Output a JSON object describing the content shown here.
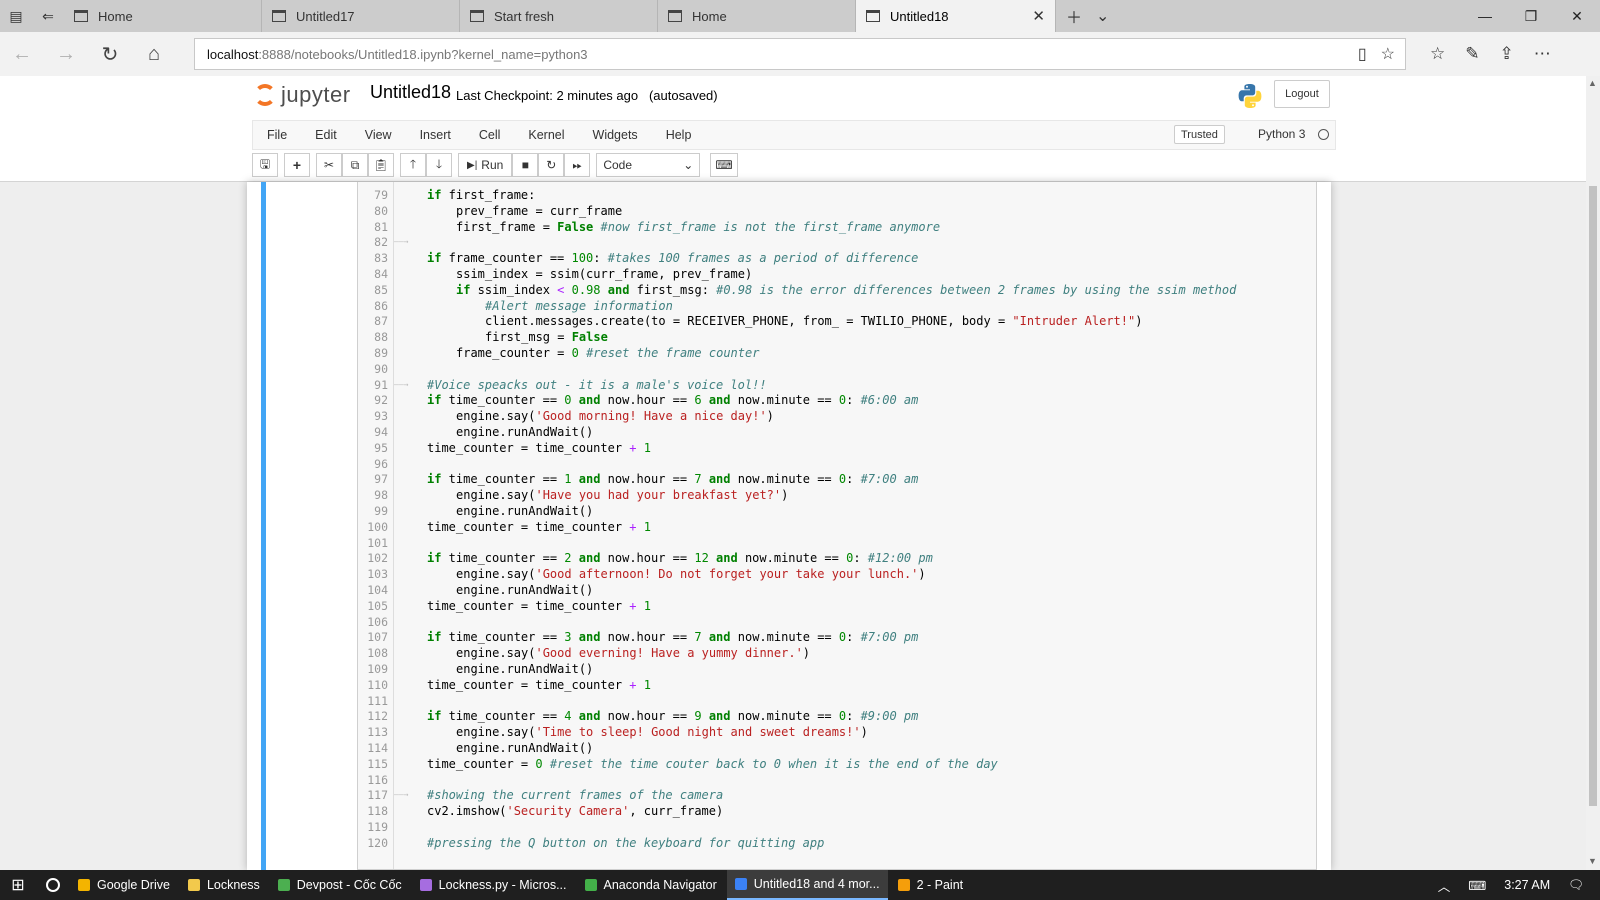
{
  "browser": {
    "tabs": [
      {
        "label": "Home",
        "active": false
      },
      {
        "label": "Untitled17",
        "active": false
      },
      {
        "label": "Start fresh",
        "active": false
      },
      {
        "label": "Home",
        "active": false
      },
      {
        "label": "Untitled18",
        "active": true
      }
    ],
    "url_host": "localhost",
    "url_rest": ":8888/notebooks/Untitled18.ipynb?kernel_name=python3"
  },
  "jupyter": {
    "logo_text": "jupyter",
    "notebook_name": "Untitled18",
    "checkpoint": "Last Checkpoint: 2 minutes ago",
    "autosave": "(autosaved)",
    "logout_label": "Logout",
    "menu": [
      "File",
      "Edit",
      "View",
      "Insert",
      "Cell",
      "Kernel",
      "Widgets",
      "Help"
    ],
    "trusted_label": "Trusted",
    "kernel_name": "Python 3",
    "run_label": "Run",
    "cell_type": "Code"
  },
  "code_lines": [
    {
      "n": "79",
      "indent": 1,
      "tokens": [
        [
          "kw",
          "if"
        ],
        [
          "t",
          " first_frame:"
        ]
      ]
    },
    {
      "n": "80",
      "indent": 2,
      "tokens": [
        [
          "t",
          "prev_frame = curr_frame"
        ]
      ]
    },
    {
      "n": "81",
      "indent": 2,
      "tokens": [
        [
          "t",
          "first_frame = "
        ],
        [
          "kw",
          "False"
        ],
        [
          "t",
          " "
        ],
        [
          "cm",
          "#now first_frame is not the first_frame anymore"
        ]
      ]
    },
    {
      "n": "82",
      "indent": 0,
      "tokens": [],
      "tabmark": true
    },
    {
      "n": "83",
      "indent": 1,
      "tokens": [
        [
          "kw",
          "if"
        ],
        [
          "t",
          " frame_counter == "
        ],
        [
          "nm",
          "100"
        ],
        [
          "t",
          ": "
        ],
        [
          "cm",
          "#takes 100 frames as a period of difference"
        ]
      ]
    },
    {
      "n": "84",
      "indent": 2,
      "tokens": [
        [
          "t",
          "ssim_index = ssim(curr_frame, prev_frame)"
        ]
      ]
    },
    {
      "n": "85",
      "indent": 2,
      "tokens": [
        [
          "kw",
          "if"
        ],
        [
          "t",
          " ssim_index "
        ],
        [
          "op",
          "<"
        ],
        [
          "t",
          " "
        ],
        [
          "nm",
          "0.98"
        ],
        [
          "t",
          " "
        ],
        [
          "kw",
          "and"
        ],
        [
          "t",
          " first_msg: "
        ],
        [
          "cm",
          "#0.98 is the error differences between 2 frames by using the ssim method"
        ]
      ]
    },
    {
      "n": "86",
      "indent": 3,
      "tokens": [
        [
          "cm",
          "#Alert message information"
        ]
      ]
    },
    {
      "n": "87",
      "indent": 3,
      "tokens": [
        [
          "t",
          "client.messages.create(to = RECEIVER_PHONE, from_ = TWILIO_PHONE, body = "
        ],
        [
          "st",
          "\"Intruder Alert!\""
        ],
        [
          "t",
          ")"
        ]
      ]
    },
    {
      "n": "88",
      "indent": 3,
      "tokens": [
        [
          "t",
          "first_msg = "
        ],
        [
          "kw",
          "False"
        ]
      ]
    },
    {
      "n": "89",
      "indent": 2,
      "tokens": [
        [
          "t",
          "frame_counter = "
        ],
        [
          "nm",
          "0"
        ],
        [
          "t",
          " "
        ],
        [
          "cm",
          "#reset the frame counter"
        ]
      ]
    },
    {
      "n": "90",
      "indent": 0,
      "tokens": []
    },
    {
      "n": "91",
      "indent": 1,
      "tokens": [
        [
          "cm",
          "#Voice speacks out - it is a male's voice lol!!"
        ]
      ],
      "tabmark": true
    },
    {
      "n": "92",
      "indent": 1,
      "tokens": [
        [
          "kw",
          "if"
        ],
        [
          "t",
          " time_counter == "
        ],
        [
          "nm",
          "0"
        ],
        [
          "t",
          " "
        ],
        [
          "kw",
          "and"
        ],
        [
          "t",
          " now.hour == "
        ],
        [
          "nm",
          "6"
        ],
        [
          "t",
          " "
        ],
        [
          "kw",
          "and"
        ],
        [
          "t",
          " now.minute == "
        ],
        [
          "nm",
          "0"
        ],
        [
          "t",
          ": "
        ],
        [
          "cm",
          "#6:00 am"
        ]
      ]
    },
    {
      "n": "93",
      "indent": 2,
      "tokens": [
        [
          "t",
          "engine.say("
        ],
        [
          "st",
          "'Good morning! Have a nice day!'"
        ],
        [
          "t",
          ")"
        ]
      ]
    },
    {
      "n": "94",
      "indent": 2,
      "tokens": [
        [
          "t",
          "engine.runAndWait()"
        ]
      ]
    },
    {
      "n": "95",
      "indent": 1,
      "tokens": [
        [
          "t",
          "time_counter = time_counter "
        ],
        [
          "op",
          "+"
        ],
        [
          "t",
          " "
        ],
        [
          "nm",
          "1"
        ]
      ]
    },
    {
      "n": "96",
      "indent": 0,
      "tokens": []
    },
    {
      "n": "97",
      "indent": 1,
      "tokens": [
        [
          "kw",
          "if"
        ],
        [
          "t",
          " time_counter == "
        ],
        [
          "nm",
          "1"
        ],
        [
          "t",
          " "
        ],
        [
          "kw",
          "and"
        ],
        [
          "t",
          " now.hour == "
        ],
        [
          "nm",
          "7"
        ],
        [
          "t",
          " "
        ],
        [
          "kw",
          "and"
        ],
        [
          "t",
          " now.minute == "
        ],
        [
          "nm",
          "0"
        ],
        [
          "t",
          ": "
        ],
        [
          "cm",
          "#7:00 am"
        ]
      ]
    },
    {
      "n": "98",
      "indent": 2,
      "tokens": [
        [
          "t",
          "engine.say("
        ],
        [
          "st",
          "'Have you had your breakfast yet?'"
        ],
        [
          "t",
          ")"
        ]
      ]
    },
    {
      "n": "99",
      "indent": 2,
      "tokens": [
        [
          "t",
          "engine.runAndWait()"
        ]
      ]
    },
    {
      "n": "100",
      "indent": 1,
      "tokens": [
        [
          "t",
          "time_counter = time_counter "
        ],
        [
          "op",
          "+"
        ],
        [
          "t",
          " "
        ],
        [
          "nm",
          "1"
        ]
      ]
    },
    {
      "n": "101",
      "indent": 0,
      "tokens": []
    },
    {
      "n": "102",
      "indent": 1,
      "tokens": [
        [
          "kw",
          "if"
        ],
        [
          "t",
          " time_counter == "
        ],
        [
          "nm",
          "2"
        ],
        [
          "t",
          " "
        ],
        [
          "kw",
          "and"
        ],
        [
          "t",
          " now.hour == "
        ],
        [
          "nm",
          "12"
        ],
        [
          "t",
          " "
        ],
        [
          "kw",
          "and"
        ],
        [
          "t",
          " now.minute == "
        ],
        [
          "nm",
          "0"
        ],
        [
          "t",
          ": "
        ],
        [
          "cm",
          "#12:00 pm"
        ]
      ]
    },
    {
      "n": "103",
      "indent": 2,
      "tokens": [
        [
          "t",
          "engine.say("
        ],
        [
          "st",
          "'Good afternoon! Do not forget your take your lunch.'"
        ],
        [
          "t",
          ")"
        ]
      ]
    },
    {
      "n": "104",
      "indent": 2,
      "tokens": [
        [
          "t",
          "engine.runAndWait()"
        ]
      ]
    },
    {
      "n": "105",
      "indent": 1,
      "tokens": [
        [
          "t",
          "time_counter = time_counter "
        ],
        [
          "op",
          "+"
        ],
        [
          "t",
          " "
        ],
        [
          "nm",
          "1"
        ]
      ]
    },
    {
      "n": "106",
      "indent": 0,
      "tokens": []
    },
    {
      "n": "107",
      "indent": 1,
      "tokens": [
        [
          "kw",
          "if"
        ],
        [
          "t",
          " time_counter == "
        ],
        [
          "nm",
          "3"
        ],
        [
          "t",
          " "
        ],
        [
          "kw",
          "and"
        ],
        [
          "t",
          " now.hour == "
        ],
        [
          "nm",
          "7"
        ],
        [
          "t",
          " "
        ],
        [
          "kw",
          "and"
        ],
        [
          "t",
          " now.minute == "
        ],
        [
          "nm",
          "0"
        ],
        [
          "t",
          ": "
        ],
        [
          "cm",
          "#7:00 pm"
        ]
      ]
    },
    {
      "n": "108",
      "indent": 2,
      "tokens": [
        [
          "t",
          "engine.say("
        ],
        [
          "st",
          "'Good everning! Have a yummy dinner.'"
        ],
        [
          "t",
          ")"
        ]
      ]
    },
    {
      "n": "109",
      "indent": 2,
      "tokens": [
        [
          "t",
          "engine.runAndWait()"
        ]
      ]
    },
    {
      "n": "110",
      "indent": 1,
      "tokens": [
        [
          "t",
          "time_counter = time_counter "
        ],
        [
          "op",
          "+"
        ],
        [
          "t",
          " "
        ],
        [
          "nm",
          "1"
        ]
      ]
    },
    {
      "n": "111",
      "indent": 0,
      "tokens": []
    },
    {
      "n": "112",
      "indent": 1,
      "tokens": [
        [
          "kw",
          "if"
        ],
        [
          "t",
          " time_counter == "
        ],
        [
          "nm",
          "4"
        ],
        [
          "t",
          " "
        ],
        [
          "kw",
          "and"
        ],
        [
          "t",
          " now.hour == "
        ],
        [
          "nm",
          "9"
        ],
        [
          "t",
          " "
        ],
        [
          "kw",
          "and"
        ],
        [
          "t",
          " now.minute == "
        ],
        [
          "nm",
          "0"
        ],
        [
          "t",
          ": "
        ],
        [
          "cm",
          "#9:00 pm"
        ]
      ]
    },
    {
      "n": "113",
      "indent": 2,
      "tokens": [
        [
          "t",
          "engine.say("
        ],
        [
          "st",
          "'Time to sleep! Good night and sweet dreams!'"
        ],
        [
          "t",
          ")"
        ]
      ]
    },
    {
      "n": "114",
      "indent": 2,
      "tokens": [
        [
          "t",
          "engine.runAndWait()"
        ]
      ]
    },
    {
      "n": "115",
      "indent": 1,
      "tokens": [
        [
          "t",
          "time_counter = "
        ],
        [
          "nm",
          "0"
        ],
        [
          "t",
          " "
        ],
        [
          "cm",
          "#reset the time couter back to 0 when it is the end of the day"
        ]
      ]
    },
    {
      "n": "116",
      "indent": 0,
      "tokens": []
    },
    {
      "n": "117",
      "indent": 1,
      "tokens": [
        [
          "cm",
          "#showing the current frames of the camera"
        ]
      ],
      "tabmark": true
    },
    {
      "n": "118",
      "indent": 1,
      "tokens": [
        [
          "t",
          "cv2.imshow("
        ],
        [
          "st",
          "'Security Camera'"
        ],
        [
          "t",
          ", curr_frame)"
        ]
      ]
    },
    {
      "n": "119",
      "indent": 0,
      "tokens": []
    },
    {
      "n": "120",
      "indent": 1,
      "tokens": [
        [
          "cm",
          "#pressing the Q button on the keyboard for quitting app"
        ]
      ]
    }
  ],
  "taskbar": {
    "items": [
      {
        "label": "Google Drive",
        "color": "#f4b400",
        "active": false
      },
      {
        "label": "Lockness",
        "color": "#f2c94c",
        "active": false
      },
      {
        "label": "Devpost - Cốc Cốc",
        "color": "#4caf50",
        "active": false
      },
      {
        "label": "Lockness.py - Micros...",
        "color": "#a66de0",
        "active": false
      },
      {
        "label": "Anaconda Navigator",
        "color": "#43b049",
        "active": false
      },
      {
        "label": "Untitled18 and 4 mor...",
        "color": "#3b82f6",
        "active": true
      },
      {
        "label": "2 - Paint",
        "color": "#f59e0b",
        "active": false
      }
    ],
    "clock": "3:27 AM"
  }
}
